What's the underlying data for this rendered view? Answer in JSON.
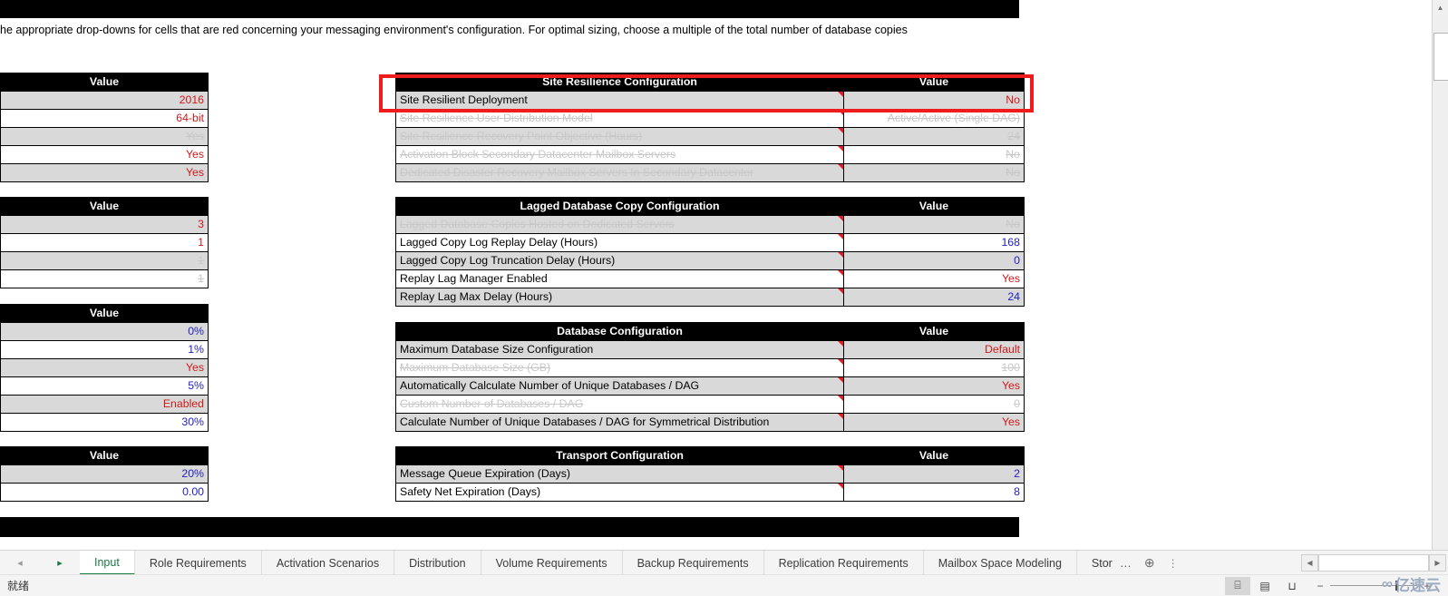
{
  "instruction": "he appropriate drop-downs for cells that are red concerning your messaging environment's configuration.  For optimal sizing, choose a multiple of the total number of database copies",
  "colors": {
    "header_bg": "#000000",
    "header_fg": "#ffffff",
    "input_red": "#d01a1a",
    "calc_blue": "#1f1fc0",
    "disabled_grey": "#c8c8c8",
    "alt_row": "#d9d9d9",
    "annotation_red": "#ee1c1c",
    "active_tab_green": "#1b7a43"
  },
  "left_blocks": [
    {
      "header": "Value",
      "rows": [
        {
          "value": "2016",
          "style": "red",
          "disabled": false
        },
        {
          "value": "64-bit",
          "style": "red",
          "disabled": false
        },
        {
          "value": "Yes",
          "style": "red",
          "disabled": true
        },
        {
          "value": "Yes",
          "style": "red",
          "disabled": false
        },
        {
          "value": "Yes",
          "style": "red",
          "disabled": false
        }
      ]
    },
    {
      "header": "Value",
      "rows": [
        {
          "value": "3",
          "style": "red",
          "disabled": false
        },
        {
          "value": "1",
          "style": "red",
          "disabled": false
        },
        {
          "value": "1",
          "style": "blue",
          "disabled": true
        },
        {
          "value": "1",
          "style": "blue",
          "disabled": true
        }
      ]
    },
    {
      "header": "Value",
      "rows": [
        {
          "value": "0%",
          "style": "blue",
          "disabled": false
        },
        {
          "value": "1%",
          "style": "blue",
          "disabled": false
        },
        {
          "value": "Yes",
          "style": "red",
          "disabled": false
        },
        {
          "value": "5%",
          "style": "blue",
          "disabled": false
        },
        {
          "value": "Enabled",
          "style": "red",
          "disabled": false
        },
        {
          "value": "30%",
          "style": "blue",
          "disabled": false
        }
      ]
    },
    {
      "header": "Value",
      "rows": [
        {
          "value": "20%",
          "style": "blue",
          "disabled": false
        },
        {
          "value": "0.00",
          "style": "blue",
          "disabled": false
        }
      ]
    }
  ],
  "right_blocks": [
    {
      "title": "Site Resilience Configuration",
      "value_header": "Value",
      "rows": [
        {
          "label": "Site Resilient Deployment",
          "value": "No",
          "style": "red",
          "disabled": false,
          "comment": true
        },
        {
          "label": "Site Resilience User Distribution Model",
          "value": "Active/Active (Single DAG)",
          "style": "red",
          "disabled": true,
          "comment": true
        },
        {
          "label": "Site Resilience Recovery Point Objective (Hours)",
          "value": "24",
          "style": "blue",
          "disabled": true,
          "comment": true
        },
        {
          "label": "Activation Block Secondary Datacenter Mailbox Servers",
          "value": "No",
          "style": "red",
          "disabled": true,
          "comment": true
        },
        {
          "label": "Dedicated Disaster Recovery Mailbox Servers In Secondary Datacenter",
          "value": "No",
          "style": "red",
          "disabled": true,
          "comment": true
        }
      ]
    },
    {
      "title": "Lagged Database Copy Configuration",
      "value_header": "Value",
      "rows": [
        {
          "label": "Lagged Database Copies Hosted on Dedicated Servers",
          "value": "No",
          "style": "red",
          "disabled": true,
          "comment": true
        },
        {
          "label": "Lagged Copy Log Replay Delay (Hours)",
          "value": "168",
          "style": "blue",
          "disabled": false,
          "comment": true
        },
        {
          "label": "Lagged Copy Log Truncation Delay (Hours)",
          "value": "0",
          "style": "blue",
          "disabled": false,
          "comment": true
        },
        {
          "label": "Replay Lag Manager Enabled",
          "value": "Yes",
          "style": "red",
          "disabled": false,
          "comment": true
        },
        {
          "label": "Replay Lag Max Delay (Hours)",
          "value": "24",
          "style": "blue",
          "disabled": false,
          "comment": true
        }
      ]
    },
    {
      "title": "Database Configuration",
      "value_header": "Value",
      "rows": [
        {
          "label": "Maximum Database Size Configuration",
          "value": "Default",
          "style": "red",
          "disabled": false,
          "comment": true
        },
        {
          "label": "Maximum Database Size (GB)",
          "value": "100",
          "style": "blue",
          "disabled": true,
          "comment": true
        },
        {
          "label": "Automatically Calculate Number of Unique Databases / DAG",
          "value": "Yes",
          "style": "red",
          "disabled": false,
          "comment": true
        },
        {
          "label": "Custom Number of Databases / DAG",
          "value": "0",
          "style": "blue",
          "disabled": true,
          "comment": true
        },
        {
          "label": "Calculate Number of Unique Databases / DAG for Symmetrical Distribution",
          "value": "Yes",
          "style": "red",
          "disabled": false,
          "comment": true
        }
      ]
    },
    {
      "title": "Transport Configuration",
      "value_header": "Value",
      "rows": [
        {
          "label": "Message Queue Expiration (Days)",
          "value": "2",
          "style": "blue",
          "disabled": false,
          "comment": true
        },
        {
          "label": "Safety Net Expiration (Days)",
          "value": "8",
          "style": "blue",
          "disabled": false,
          "comment": true
        }
      ]
    }
  ],
  "sheet_tabs": {
    "nav": {
      "prev": "◂",
      "next": "▸"
    },
    "tabs": [
      {
        "label": "Input",
        "active": true
      },
      {
        "label": "Role Requirements",
        "active": false
      },
      {
        "label": "Activation Scenarios",
        "active": false
      },
      {
        "label": "Distribution",
        "active": false
      },
      {
        "label": "Volume Requirements",
        "active": false
      },
      {
        "label": "Backup Requirements",
        "active": false
      },
      {
        "label": "Replication Requirements",
        "active": false
      },
      {
        "label": "Mailbox Space Modeling",
        "active": false
      },
      {
        "label": "Stor",
        "active": false
      }
    ],
    "overflow": "…",
    "add_sheet": "⊕",
    "more": "⋮"
  },
  "status": {
    "text": "就绪",
    "views": [
      {
        "name": "normal-view",
        "glyph": "⌸",
        "selected": true
      },
      {
        "name": "page-layout-view",
        "glyph": "▤",
        "selected": false
      },
      {
        "name": "page-break-view",
        "glyph": "⊔",
        "selected": false
      }
    ],
    "zoom_out": "−",
    "zoom_in": "+"
  },
  "watermark": {
    "glyph": "∞",
    "text": "亿速云"
  }
}
